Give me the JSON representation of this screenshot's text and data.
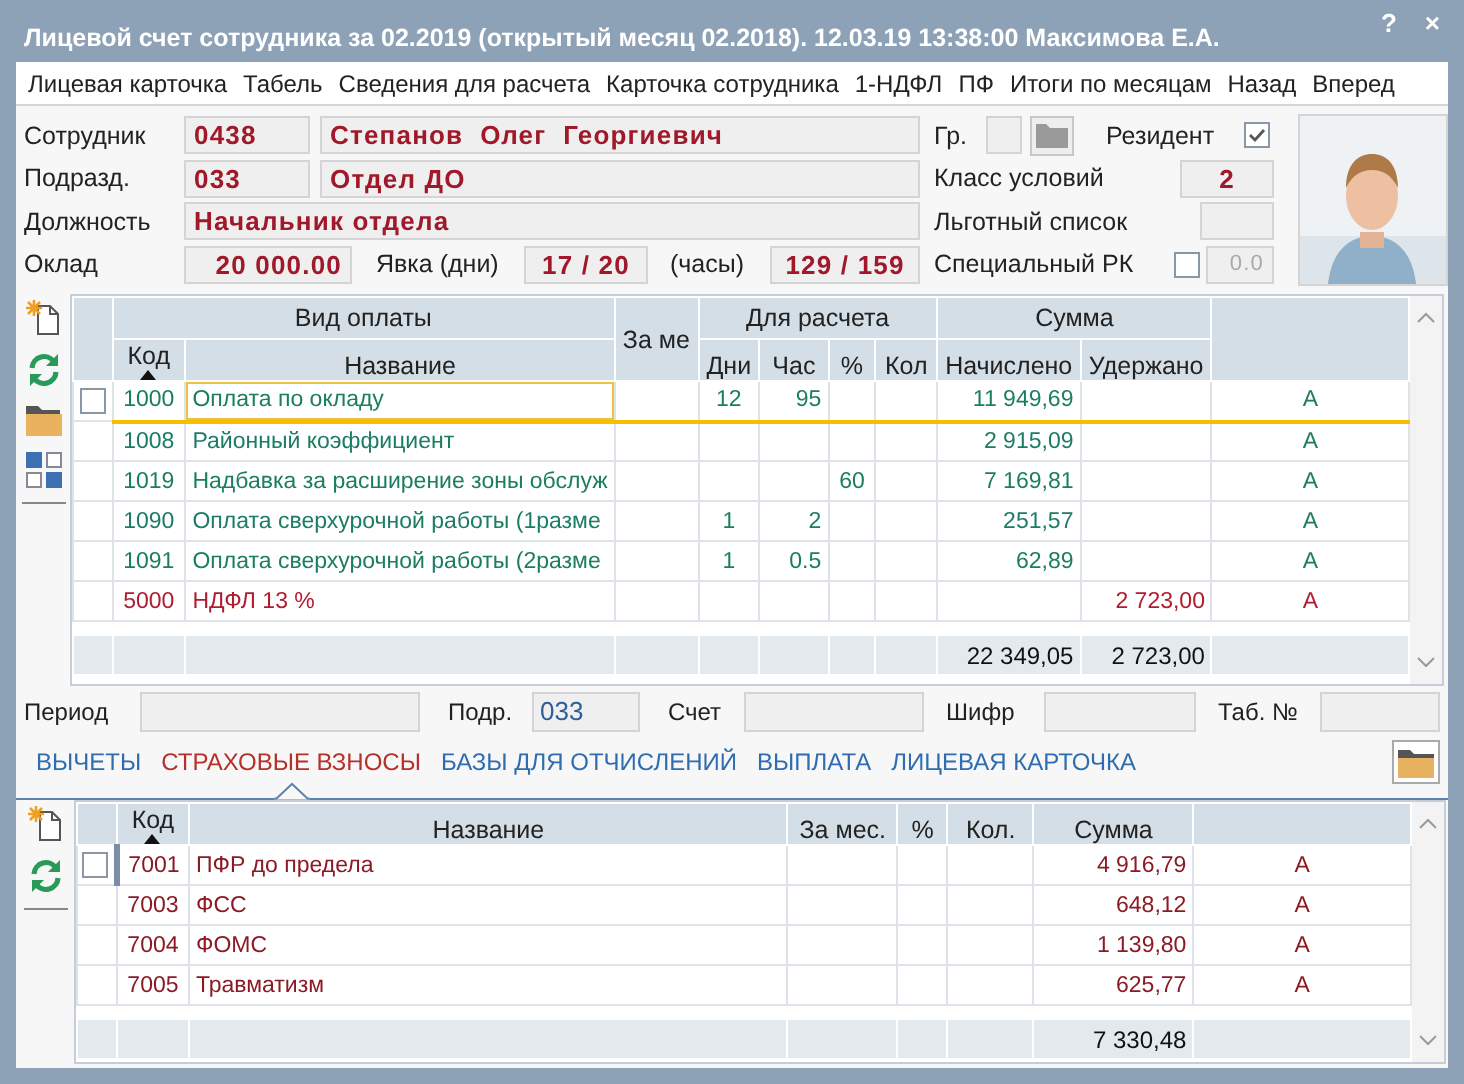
{
  "window": {
    "title": "Лицевой счет сотрудника за 02.2019 (открытый месяц 02.2018). 12.03.19 13:38:00 Максимова Е.А.",
    "controls": [
      "?",
      "×"
    ]
  },
  "menu": [
    "Лицевая карточка",
    "Табель",
    "Сведения для расчета",
    "Карточка сотрудника",
    "1-НДФЛ",
    "ПФ",
    "Итоги по месяцам",
    "Назад",
    "Вперед"
  ],
  "employee": {
    "employee_label": "Сотрудник",
    "employee_code": "0438",
    "employee_name": "Степанов  Олег  Георгиевич",
    "department_label": "Подразд.",
    "department_code": "033",
    "department_name": "Отдел ДО",
    "position_label": "Должность",
    "position": "Начальник отдела",
    "salary_label": "Оклад",
    "salary": "20 000.00",
    "attendance_days_label": "Явка (дни)",
    "attendance_days": "17 / 20",
    "attendance_hours_label": "(часы)",
    "attendance_hours": "129 / 159",
    "group_label": "Гр.",
    "resident": {
      "label": "Резидент",
      "checked": true
    },
    "conditions_class_label": "Класс условий",
    "conditions_class": "2",
    "benefit_list_label": "Льготный список",
    "special_rk": {
      "label": "Специальный РК",
      "checked": false,
      "value": "0.0",
      "disabled": true
    }
  },
  "payments": {
    "header_groups": [
      {
        "label": "Вид оплаты",
        "columns": [
          {
            "label": "Код",
            "sorted": true
          },
          {
            "label": "Название",
            "sorted": false
          }
        ]
      },
      {
        "columns": [
          {
            "label": "За ме",
            "sorted": false
          }
        ]
      },
      {
        "label": "Для расчета",
        "columns": [
          {
            "label": "Дни",
            "sorted": false
          },
          {
            "label": "Час",
            "sorted": false
          },
          {
            "label": "%",
            "sorted": false
          },
          {
            "label": "Кол",
            "sorted": false
          }
        ]
      },
      {
        "label": "Сумма",
        "columns": [
          {
            "label": "Начислено",
            "sorted": false
          },
          {
            "label": "Удержано",
            "sorted": false
          }
        ]
      }
    ],
    "rows": [
      {
        "code": "1000",
        "name": "Оплата по окладу",
        "days": "12",
        "hours": "95",
        "accrued": "11 949,69",
        "flag": "А",
        "kind": "accrual",
        "selected": true,
        "checked": false
      },
      {
        "code": "1008",
        "name": "Районный коэффициент",
        "accrued": "2 915,09",
        "flag": "А",
        "kind": "accrual",
        "selected": false
      },
      {
        "code": "1019",
        "name": "Надбавка за расширение зоны обслуж",
        "percent": "60",
        "accrued": "7 169,81",
        "flag": "А",
        "kind": "accrual",
        "selected": false
      },
      {
        "code": "1090",
        "name": "Оплата сверхурочной работы (1разме",
        "days": "1",
        "hours": "2",
        "accrued": "251,57",
        "flag": "А",
        "kind": "accrual",
        "selected": false
      },
      {
        "code": "1091",
        "name": "Оплата сверхурочной работы (2разме",
        "days": "1",
        "hours": "0.5",
        "accrued": "62,89",
        "flag": "А",
        "kind": "accrual",
        "selected": false
      },
      {
        "code": "5000",
        "name": "НДФЛ 13 %",
        "withheld": "2 723,00",
        "flag": "А",
        "kind": "deduction",
        "selected": false
      }
    ],
    "totals": {
      "accrued": "22 349,05",
      "withheld": "2 723,00"
    }
  },
  "filters": [
    {
      "label": "Период"
    },
    {
      "label": "Подр.",
      "value": "033"
    },
    {
      "label": "Счет"
    },
    {
      "label": "Шифр"
    },
    {
      "label": "Таб. №"
    }
  ],
  "tabs": [
    {
      "label": "ВЫЧЕТЫ",
      "selected": false
    },
    {
      "label": "СТРАХОВЫЕ ВЗНОСЫ",
      "selected": true
    },
    {
      "label": "БАЗЫ ДЛЯ ОТЧИСЛЕНИЙ",
      "selected": false
    },
    {
      "label": "ВЫПЛАТА",
      "selected": false
    },
    {
      "label": "ЛИЦЕВАЯ КАРТОЧКА",
      "selected": false
    }
  ],
  "insurance": {
    "columns": [
      {
        "label": "Код",
        "sorted": true
      },
      {
        "label": "Название",
        "sorted": false
      },
      {
        "label": "За мес.",
        "sorted": false
      },
      {
        "label": "%",
        "sorted": false
      },
      {
        "label": "Кол.",
        "sorted": false
      },
      {
        "label": "Сумма",
        "sorted": false
      }
    ],
    "rows": [
      {
        "code": "7001",
        "name": "ПФР до предела",
        "amount": "4 916,79",
        "flag": "А",
        "selected": true,
        "checked": false
      },
      {
        "code": "7003",
        "name": "ФСС",
        "amount": "648,12",
        "flag": "А",
        "selected": false
      },
      {
        "code": "7004",
        "name": "ФОМС",
        "amount": "1 139,80",
        "flag": "А",
        "selected": false
      },
      {
        "code": "7005",
        "name": "Травматизм",
        "amount": "625,77",
        "flag": "А",
        "selected": false
      }
    ],
    "total": "7 330,48"
  }
}
